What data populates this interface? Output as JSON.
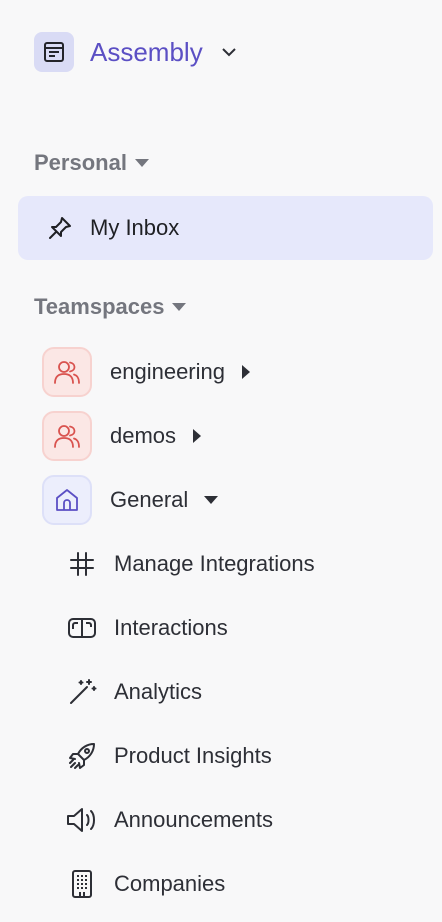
{
  "header": {
    "app_name": "Assembly",
    "app_icon": "app-window-icon",
    "chevron": "chevron-down-icon"
  },
  "personal": {
    "label": "Personal",
    "items": [
      {
        "label": "My Inbox",
        "icon": "pin-icon",
        "selected": true
      }
    ]
  },
  "teamspaces": {
    "label": "Teamspaces",
    "teams": [
      {
        "label": "engineering",
        "icon": "users-icon",
        "color": "#d9534f",
        "expanded": false
      },
      {
        "label": "demos",
        "icon": "users-icon",
        "color": "#d9534f",
        "expanded": false
      },
      {
        "label": "General",
        "icon": "home-icon",
        "color": "#5b4fc4",
        "expanded": true
      }
    ],
    "general_items": [
      {
        "label": "Manage Integrations",
        "icon": "hash-icon"
      },
      {
        "label": "Interactions",
        "icon": "inbox-card-icon"
      },
      {
        "label": "Analytics",
        "icon": "magic-wand-icon"
      },
      {
        "label": "Product Insights",
        "icon": "rocket-icon"
      },
      {
        "label": "Announcements",
        "icon": "megaphone-icon"
      },
      {
        "label": "Companies",
        "icon": "building-icon"
      }
    ]
  },
  "colors": {
    "accent": "#5b4fc4",
    "selected_bg": "#e6e8fb",
    "team_red": "#d9534f"
  }
}
